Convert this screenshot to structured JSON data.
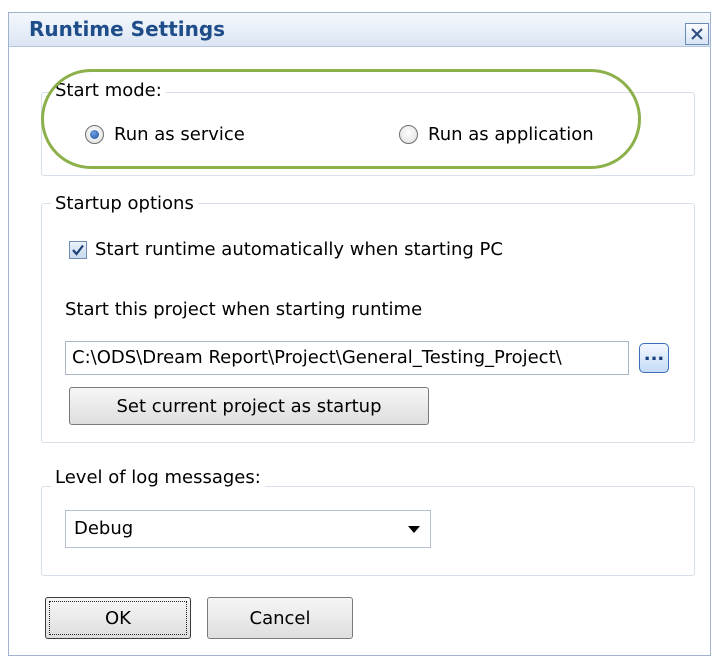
{
  "window": {
    "title": "Runtime Settings",
    "close_icon": "close-icon"
  },
  "start_mode": {
    "legend": "Start mode:",
    "options": [
      {
        "label": "Run as service",
        "checked": true
      },
      {
        "label": "Run as application",
        "checked": false
      }
    ],
    "highlight_color": "#8cb04a"
  },
  "startup_options": {
    "legend": "Startup options",
    "auto_start": {
      "label": "Start runtime automatically when starting PC",
      "checked": true
    },
    "project_label": "Start this project when starting runtime",
    "project_path": "C:\\ODS\\Dream Report\\Project\\General_Testing_Project\\",
    "browse_label": "...",
    "set_current_label": "Set current project as startup"
  },
  "log_level": {
    "legend": "Level of log messages:",
    "selected": "Debug"
  },
  "footer": {
    "ok_label": "OK",
    "cancel_label": "Cancel"
  },
  "colors": {
    "title_text": "#1f4d8a",
    "accent_blue": "#3d6fb8"
  }
}
